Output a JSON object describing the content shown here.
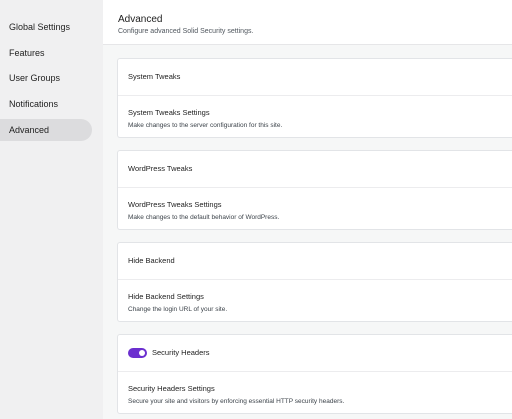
{
  "sidebar": {
    "items": [
      {
        "label": "Global Settings",
        "active": false
      },
      {
        "label": "Features",
        "active": false
      },
      {
        "label": "User Groups",
        "active": false
      },
      {
        "label": "Notifications",
        "active": false
      },
      {
        "label": "Advanced",
        "active": true
      }
    ]
  },
  "header": {
    "title": "Advanced",
    "subtitle": "Configure advanced Solid Security settings."
  },
  "sections": [
    {
      "title": "System Tweaks",
      "settings_title": "System Tweaks Settings",
      "settings_desc": "Make changes to the server configuration for this site."
    },
    {
      "title": "WordPress Tweaks",
      "settings_title": "WordPress Tweaks Settings",
      "settings_desc": "Make changes to the default behavior of WordPress."
    },
    {
      "title": "Hide Backend",
      "settings_title": "Hide Backend Settings",
      "settings_desc": "Change the login URL of your site."
    },
    {
      "title": "Security Headers",
      "settings_title": "Security Headers Settings",
      "settings_desc": "Secure your site and visitors by enforcing essential HTTP security headers.",
      "toggle_enabled": true
    }
  ],
  "colors": {
    "accent": "#6b2fcf",
    "active_nav_bg": "#dcdcde"
  }
}
